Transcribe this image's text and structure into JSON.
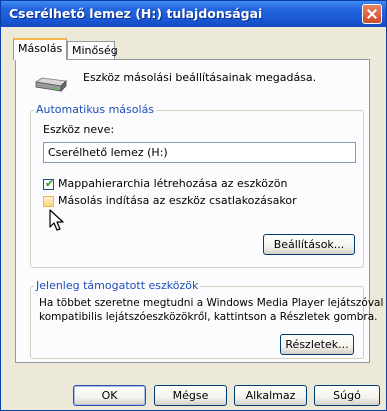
{
  "window": {
    "title": "Cserélhető lemez (H:) tulajdonságai"
  },
  "tabs": [
    {
      "label": "Másolás",
      "active": true
    },
    {
      "label": "Minőség",
      "active": false
    }
  ],
  "intro": {
    "icon": "removable-drive-icon",
    "text": "Eszköz másolási beállításainak megadása."
  },
  "auto_copy": {
    "group_label": "Automatikus másolás",
    "device_name_label": "Eszköz neve:",
    "device_name_value": "Cserélhető lemez (H:)",
    "checkboxes": [
      {
        "label": "Mappahierarchia létrehozása az eszközön",
        "checked": true
      },
      {
        "label": "Másolás indítása az eszköz csatlakozásakor",
        "checked": false
      }
    ],
    "settings_button": "Beállítások..."
  },
  "supported": {
    "group_label": "Jelenleg támogatott eszközök",
    "line1": "Ha többet szeretne megtudni a Windows Media Player lejátszóval",
    "line2": "kompatibilis lejátszóeszközökről, kattintson a Részletek gombra.",
    "details_button": "Részletek..."
  },
  "buttons": {
    "ok": "OK",
    "cancel": "Mégse",
    "apply": "Alkalmaz",
    "help": "Súgó"
  }
}
